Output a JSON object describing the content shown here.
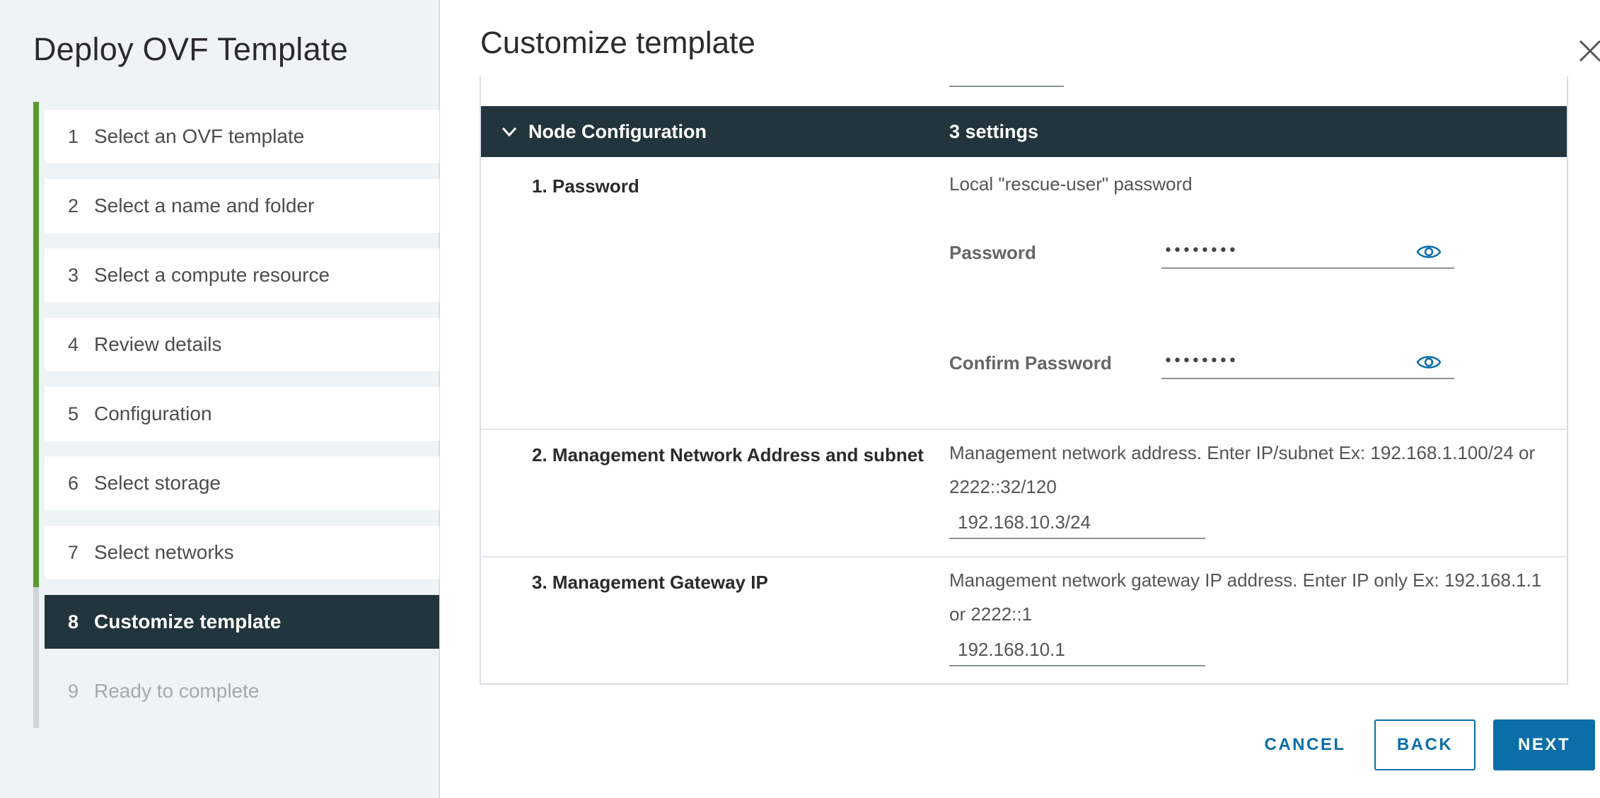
{
  "wizard": {
    "title": "Deploy OVF Template",
    "steps": [
      {
        "num": "1",
        "label": "Select an OVF template"
      },
      {
        "num": "2",
        "label": "Select a name and folder"
      },
      {
        "num": "3",
        "label": "Select a compute resource"
      },
      {
        "num": "4",
        "label": "Review details"
      },
      {
        "num": "5",
        "label": "Configuration"
      },
      {
        "num": "6",
        "label": "Select storage"
      },
      {
        "num": "7",
        "label": "Select networks"
      },
      {
        "num": "8",
        "label": "Customize template"
      },
      {
        "num": "9",
        "label": "Ready to complete"
      }
    ],
    "current_step": 8
  },
  "page": {
    "title": "Customize template"
  },
  "prev_field_value": "•••",
  "group": {
    "name": "Node Configuration",
    "count": "3 settings"
  },
  "settings": {
    "password": {
      "name": "1. Password",
      "description": "Local \"rescue-user\" password",
      "password_label": "Password",
      "password_value": "••••••••",
      "confirm_label": "Confirm Password",
      "confirm_value": "••••••••"
    },
    "mgmt_address": {
      "name": "2. Management Network Address and subnet",
      "description": "Management network address. Enter IP/subnet Ex: 192.168.1.100/24 or 2222::32/120",
      "value": "192.168.10.3/24"
    },
    "mgmt_gateway": {
      "name": "3. Management Gateway IP",
      "description": "Management network gateway IP address. Enter IP only Ex: 192.168.1.1 or 2222::1",
      "value": "192.168.10.1"
    }
  },
  "footer": {
    "cancel": "CANCEL",
    "back": "BACK",
    "next": "NEXT"
  },
  "colors": {
    "accent": "#0b6ea8",
    "header_dark": "#22343c",
    "progress_done": "#5a9a2a"
  }
}
